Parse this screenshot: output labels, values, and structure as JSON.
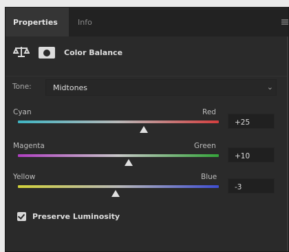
{
  "tabs": [
    {
      "label": "Properties",
      "active": true
    },
    {
      "label": "Info",
      "active": false
    }
  ],
  "adjustment": {
    "title": "Color Balance",
    "adjustment_icon": "balance-scale-icon",
    "mask_icon": "layer-mask-icon"
  },
  "tone": {
    "label": "Tone:",
    "value": "Midtones",
    "chevron": "chevron-down-icon"
  },
  "sliders": [
    {
      "left_label": "Cyan",
      "right_label": "Red",
      "value": "+25",
      "position": 0.625
    },
    {
      "left_label": "Magenta",
      "right_label": "Green",
      "value": "+10",
      "position": 0.55
    },
    {
      "left_label": "Yellow",
      "right_label": "Blue",
      "value": "-3",
      "position": 0.485
    }
  ],
  "preserve_luminosity": {
    "label": "Preserve Luminosity",
    "checked": true
  },
  "colors": {
    "panel_bg": "#2a2a2a",
    "tab_active_bg": "#353535",
    "cyan": "#3fb5c3",
    "red": "#d33e3e",
    "magenta": "#b03fc2",
    "green": "#34a53a",
    "yellow": "#d2d23a",
    "blue": "#3f4ed2"
  }
}
